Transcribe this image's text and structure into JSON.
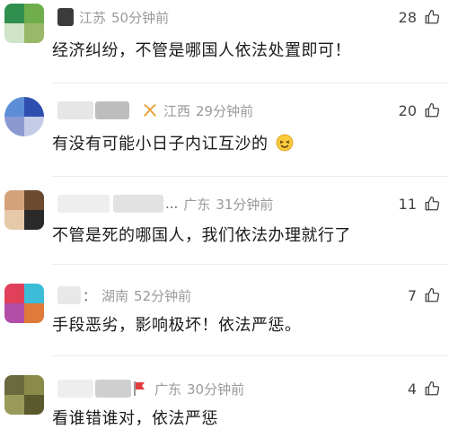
{
  "comments": [
    {
      "region": "江苏",
      "time": "50分钟前",
      "likes": "28",
      "text": "经济纠纷，不管是哪国人依法处置即可！",
      "avatar_colors": [
        "#2f8f4e",
        "#6fae4a",
        "#cfe3c7",
        "#9ab86a"
      ],
      "name_blur_color": "#3b3b3b"
    },
    {
      "region": "江西",
      "time": "29分钟前",
      "likes": "20",
      "text": "有没有可能小日子内讧互沙的",
      "avatar_colors": [
        "#5b8ed6",
        "#2f4fb0",
        "#8a9ad0",
        "#c5cce8"
      ],
      "name_blur_color": "#bdbdbd",
      "badge_icon": "ribbon-icon"
    },
    {
      "region": "广东",
      "time": "31分钟前",
      "likes": "11",
      "text": "不管是死的哪国人，我们依法办理就行了",
      "avatar_colors": [
        "#d3a27a",
        "#6b4a30",
        "#e6c9a8",
        "#2a2a2a"
      ],
      "name_blur_color": "#e2e2e2",
      "name_suffix": "..."
    },
    {
      "region": "湖南",
      "time": "52分钟前",
      "likes": "7",
      "text": "手段恶劣，影响极坏！依法严惩。",
      "avatar_colors": [
        "#e0405a",
        "#3dbcd8",
        "#b24ea8",
        "#e07a3a"
      ],
      "name_blur_color": "#e8e8e8",
      "name_suffix": "："
    },
    {
      "region": "广东",
      "time": "30分钟前",
      "likes": "4",
      "text": "看谁错谁对，依法严惩",
      "avatar_colors": [
        "#6b6a3c",
        "#8a8a4a",
        "#9a9a5a",
        "#5a5a2e"
      ],
      "name_blur_color": "#cfcfcf",
      "flag_color": "#e23b3b"
    }
  ]
}
